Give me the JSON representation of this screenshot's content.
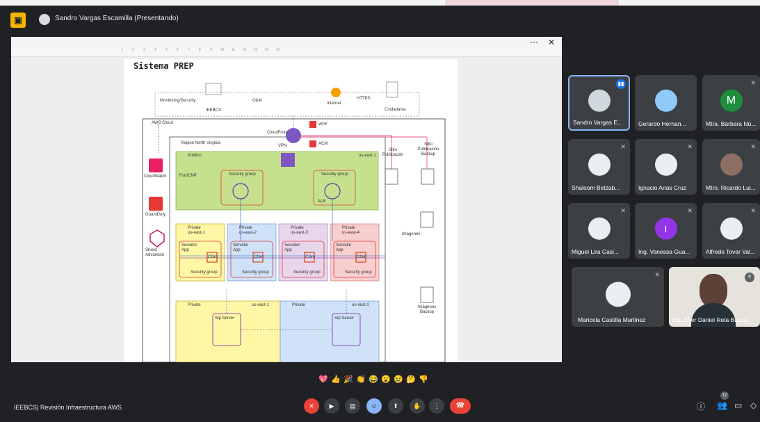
{
  "presenter": {
    "name": "Sandro Vargas Escamilla (Presentando)"
  },
  "presentation": {
    "doc_title": "Sistema PREP",
    "ruler_numbers": [
      "1",
      "2",
      "3",
      "4",
      "5",
      "6",
      "7",
      "8",
      "9",
      "10",
      "11",
      "12",
      "13",
      "14",
      "15"
    ],
    "diagram": {
      "monitoring": "Monitoring/Security",
      "om": "O&M",
      "ieebcs": "IEEBCS",
      "internet": "Internet",
      "https": "HTTPS",
      "ciudadania": "Ciudadania",
      "aws_cloud": "AWS Cloud",
      "cloudfront": "CloudFront",
      "waf": "WAF",
      "acm": "ACM",
      "vpn": "VPN",
      "region": "Region North Virginia",
      "publico": "Publico",
      "us_east_1": "us-east-1",
      "forticnp": "FortiCNP",
      "security_group": "Security group",
      "alb": "ALB",
      "cloudwatch": "CloudWatch",
      "guardduty": "GuardDuty",
      "shield": "Shield Advanced",
      "sitio_pub": "Sitio Publicación",
      "sitio_pub_backup": "Sitio Publicación Backup",
      "imagenes": "Imágenes",
      "imagenes_backup": "Imágenes Backup",
      "private": "Private",
      "private_zones": [
        "us-east-1",
        "us-east-2",
        "us-east-3",
        "us-east-4"
      ],
      "servidor": "Servidor App",
      "cgm": "CGm",
      "private_db_left": "us-east-1",
      "private_db_right": "us-east-2",
      "sql_server": "Sql Server"
    }
  },
  "participants": [
    {
      "name": "Sandro Vargas E...",
      "speaking": true,
      "initial": ""
    },
    {
      "name": "Gerardo Hernan...",
      "initial": ""
    },
    {
      "name": "Mtra. Bárbara Nú...",
      "initial": "M"
    },
    {
      "name": "Shaloom Betzab...",
      "initial": ""
    },
    {
      "name": "Ignacio Arias Cruz",
      "initial": ""
    },
    {
      "name": "Mtro. Ricardo Lui...",
      "initial": ""
    },
    {
      "name": "Miguel Lira Casi...",
      "initial": ""
    },
    {
      "name": "Ing. Vanessa Gua...",
      "initial": "I"
    },
    {
      "name": "Alfredo Tovar Val...",
      "initial": ""
    },
    {
      "name": "Maricela Castilla Martinez",
      "initial": ""
    },
    {
      "name": "Ing. Eber Daniel Reta Baeza",
      "initial": ""
    }
  ],
  "meeting": {
    "title": "IEEBCS| Revisión Infraestructura AWS",
    "people_count": "12"
  },
  "reactions": [
    "💖",
    "👍",
    "🎉",
    "👏",
    "😂",
    "😮",
    "😢",
    "🤔",
    "👎"
  ],
  "colors": {
    "leave": "#ea4335",
    "accent": "#8ab4f8",
    "tile": "#3c4043"
  }
}
